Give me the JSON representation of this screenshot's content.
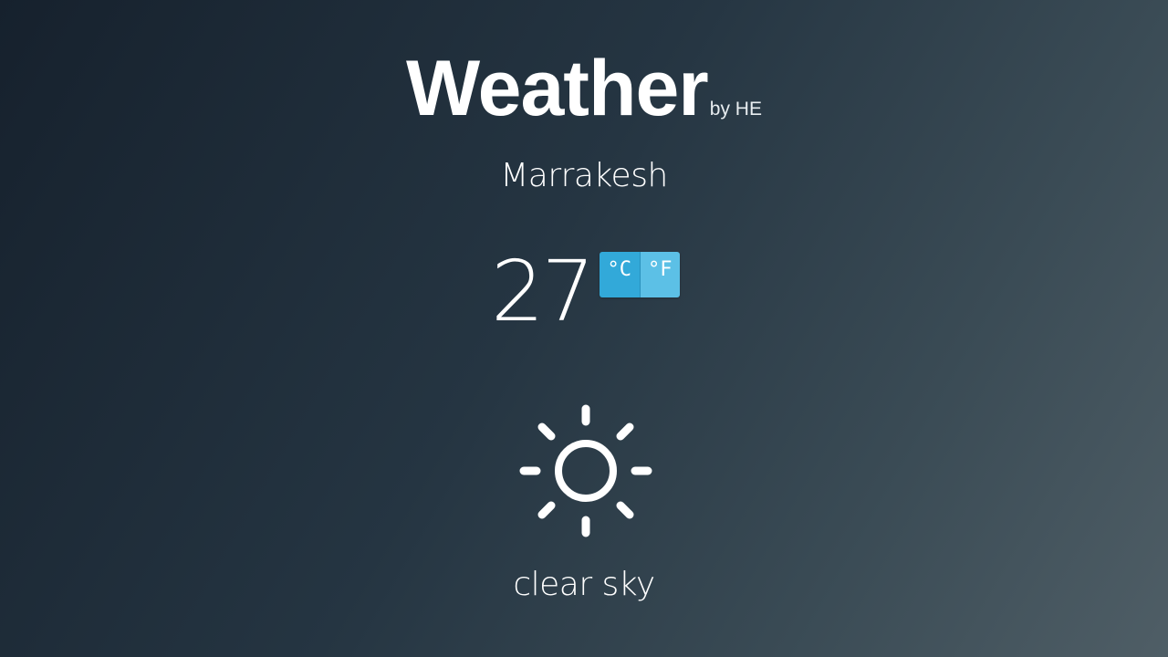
{
  "app": {
    "title": "Weather",
    "byline": "by HE"
  },
  "location": {
    "city": "Marrakesh"
  },
  "current": {
    "temperature": "27",
    "units": {
      "celsius_label": "°C",
      "fahrenheit_label": "°F",
      "selected": "celsius"
    },
    "icon": "sun-icon",
    "condition": "clear sky"
  },
  "colors": {
    "toggle_active": "#32a9d9",
    "toggle_inactive": "#5cc0e6",
    "background_dark": "#16212d",
    "background_light": "#4f5e66",
    "text": "#ffffff"
  }
}
